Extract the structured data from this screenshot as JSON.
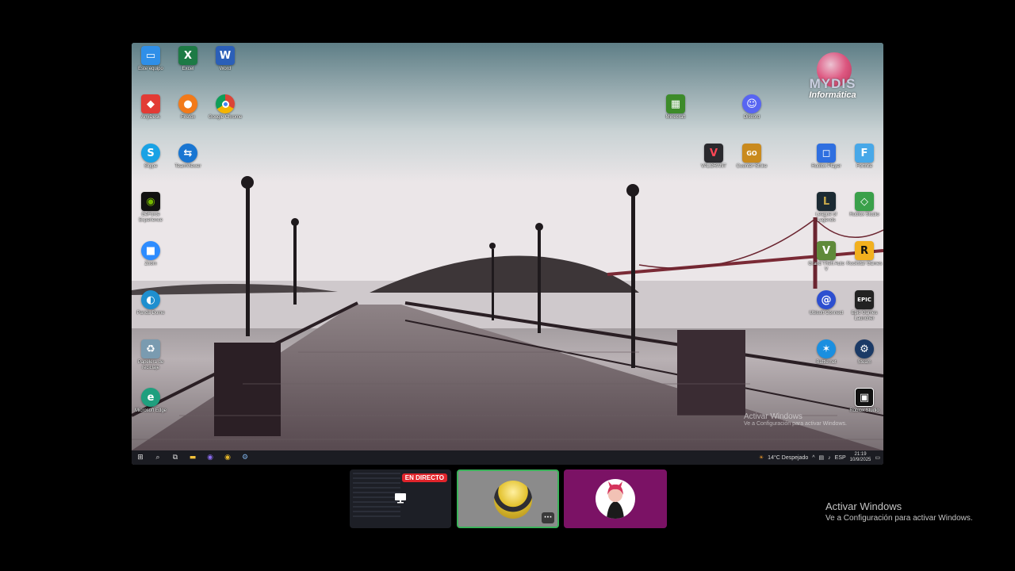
{
  "desktop": {
    "icons_left": [
      {
        "label": "Este equipo",
        "icon": "computer-icon",
        "color": "#2f8fe8"
      },
      {
        "label": "Excel",
        "icon": "excel-icon",
        "color": "#1d7a45"
      },
      {
        "label": "Word",
        "icon": "word-icon",
        "color": "#2b5fb8"
      },
      {
        "label": "AnyDesk",
        "icon": "anydesk-icon",
        "color": "#e23b35"
      },
      {
        "label": "Firefox",
        "icon": "firefox-icon",
        "color": "#f27a1a"
      },
      {
        "label": "Google Chrome",
        "icon": "chrome-icon",
        "color": "#e4b52a"
      },
      {
        "label": "Skype",
        "icon": "skype-icon",
        "color": "#19a2e5"
      },
      {
        "label": "TeamViewer",
        "icon": "teamviewer-icon",
        "color": "#1976d2"
      },
      {
        "label": "GeForce Experience",
        "icon": "nvidia-icon",
        "color": "#6aa516"
      },
      {
        "label": "Zoom",
        "icon": "zoom-icon",
        "color": "#2d8cff"
      },
      {
        "label": "Panda Dome",
        "icon": "panda-icon",
        "color": "#1f8fcf"
      },
      {
        "label": "Papelera de reciclaje",
        "icon": "recycle-bin-icon",
        "color": "#7a9bb0"
      },
      {
        "label": "Microsoft Edge",
        "icon": "edge-icon",
        "color": "#1f9f7e"
      }
    ],
    "icons_right": [
      {
        "label": "Minecraft",
        "icon": "minecraft-icon",
        "color": "#3d8b2a"
      },
      {
        "label": "Discord",
        "icon": "discord-icon",
        "color": "#5865f2"
      },
      {
        "label": "VALORANT",
        "icon": "valorant-icon",
        "color": "#2a2a2e"
      },
      {
        "label": "Counter-Strike",
        "icon": "counter-strike-icon",
        "color": "#c98a1e"
      },
      {
        "label": "Roblox Player",
        "icon": "roblox-icon",
        "color": "#2f6fe0"
      },
      {
        "label": "Fortnite",
        "icon": "fortnite-icon",
        "color": "#48a8e8"
      },
      {
        "label": "League of Legends",
        "icon": "league-icon",
        "color": "#b8962e"
      },
      {
        "label": "Roblox Studio",
        "icon": "roblox-studio-icon",
        "color": "#3aa04a"
      },
      {
        "label": "Grand Theft Auto V",
        "icon": "gta-icon",
        "color": "#5f8a3a"
      },
      {
        "label": "Rockstar Games",
        "icon": "rockstar-icon",
        "color": "#f2b01e"
      },
      {
        "label": "Ubisoft Connect",
        "icon": "ubisoft-icon",
        "color": "#2d4fd0"
      },
      {
        "label": "Epic Games Launcher",
        "icon": "epic-games-icon",
        "color": "#222"
      },
      {
        "label": "Battle.net",
        "icon": "battlenet-icon",
        "color": "#1a8fe0"
      },
      {
        "label": "Steam",
        "icon": "steam-icon",
        "color": "#1b3a66"
      },
      {
        "label": "Roblox Studio",
        "icon": "roblox-studio-mode-icon",
        "color": "#111"
      }
    ],
    "logo": {
      "line1": "MYDIS",
      "line2": "Informática"
    },
    "activate": {
      "title": "Activar Windows",
      "subtitle": "Ve a Configuración para activar Windows."
    }
  },
  "taskbar": {
    "weather": "14°C  Despejado",
    "lang": "ESP",
    "time": "21:19",
    "date": "10/9/2025"
  },
  "participants": {
    "live_badge": "EN DIRECTO",
    "more_label": "···"
  },
  "overlay": {
    "activate_title": "Activar Windows",
    "activate_subtitle": "Ve a Configuración para activar Windows."
  }
}
